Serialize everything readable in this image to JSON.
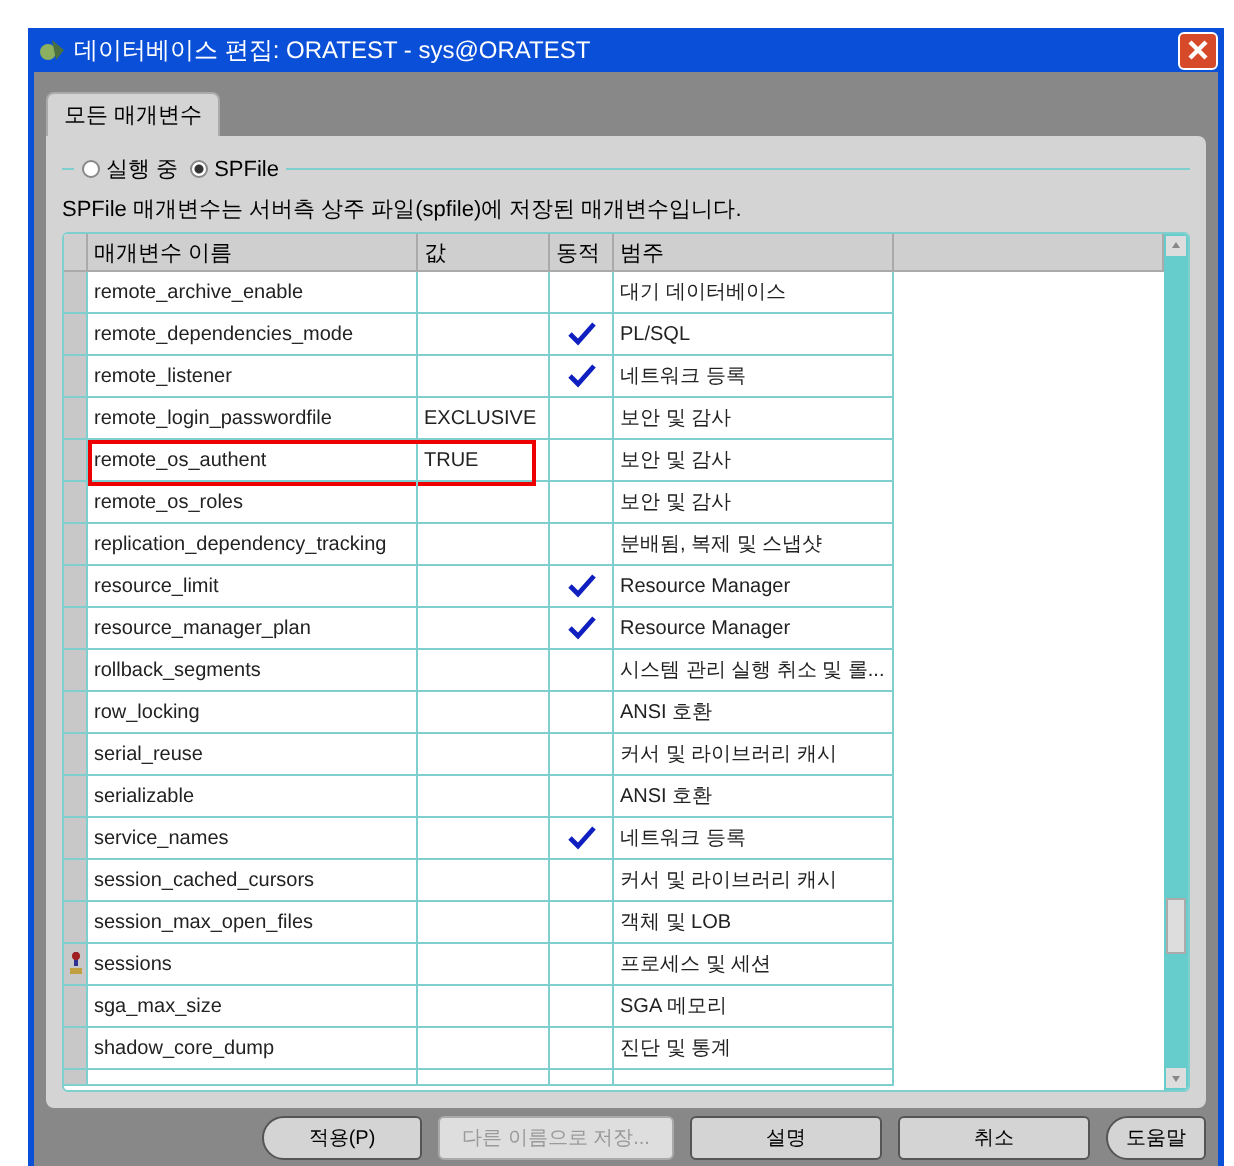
{
  "window": {
    "title": "데이터베이스 편집: ORATEST - sys@ORATEST"
  },
  "tabs": [
    {
      "label": "모든 매개변수",
      "selected": true
    }
  ],
  "source_options": [
    {
      "label": "실행 중",
      "selected": false
    },
    {
      "label": "SPFile",
      "selected": true
    }
  ],
  "description": "SPFile 매개변수는 서버측 상주 파일(spfile)에 저장된 매개변수입니다.",
  "table": {
    "columns": [
      "매개변수 이름",
      "값",
      "동적",
      "범주"
    ],
    "rows": [
      {
        "name": "remote_archive_enable",
        "dynamic": false,
        "category": "대기 데이터베이스",
        "highlighted": false,
        "flagged": false
      },
      {
        "name": "remote_dependencies_mode",
        "dynamic": true,
        "category": "PL/SQL",
        "highlighted": false,
        "flagged": false
      },
      {
        "name": "remote_listener",
        "dynamic": true,
        "category": "네트워크 등록",
        "highlighted": false,
        "flagged": false
      },
      {
        "name": "remote_login_passwordfile",
        "value": "EXCLUSIVE",
        "dynamic": false,
        "category": "보안 및 감사",
        "highlighted": false,
        "flagged": false
      },
      {
        "name": "remote_os_authent",
        "value": "TRUE",
        "dynamic": false,
        "category": "보안 및 감사",
        "highlighted": true,
        "flagged": false
      },
      {
        "name": "remote_os_roles",
        "dynamic": false,
        "category": "보안 및 감사",
        "highlighted": false,
        "flagged": false
      },
      {
        "name": "replication_dependency_tracking",
        "dynamic": false,
        "category": "분배됨, 복제 및 스냅샷",
        "highlighted": false,
        "flagged": false
      },
      {
        "name": "resource_limit",
        "dynamic": true,
        "category": "Resource Manager",
        "highlighted": false,
        "flagged": false
      },
      {
        "name": "resource_manager_plan",
        "dynamic": true,
        "category": "Resource Manager",
        "highlighted": false,
        "flagged": false
      },
      {
        "name": "rollback_segments",
        "dynamic": false,
        "category": "시스템 관리 실행 취소 및 롤...",
        "highlighted": false,
        "flagged": false
      },
      {
        "name": "row_locking",
        "dynamic": false,
        "category": "ANSI 호환",
        "highlighted": false,
        "flagged": false
      },
      {
        "name": "serial_reuse",
        "dynamic": false,
        "category": "커서 및 라이브러리 캐시",
        "highlighted": false,
        "flagged": false
      },
      {
        "name": "serializable",
        "dynamic": false,
        "category": "ANSI 호환",
        "highlighted": false,
        "flagged": false
      },
      {
        "name": "service_names",
        "dynamic": true,
        "category": "네트워크 등록",
        "highlighted": false,
        "flagged": false
      },
      {
        "name": "session_cached_cursors",
        "dynamic": false,
        "category": "커서 및 라이브러리 캐시",
        "highlighted": false,
        "flagged": false
      },
      {
        "name": "session_max_open_files",
        "dynamic": false,
        "category": "객체 및 LOB",
        "highlighted": false,
        "flagged": false
      },
      {
        "name": "sessions",
        "dynamic": false,
        "category": "프로세스 및 세션",
        "highlighted": false,
        "flagged": true
      },
      {
        "name": "sga_max_size",
        "dynamic": false,
        "category": "SGA 메모리",
        "highlighted": false,
        "flagged": false
      },
      {
        "name": "shadow_core_dump",
        "dynamic": false,
        "category": "진단 및 통계",
        "highlighted": false,
        "flagged": false
      }
    ]
  },
  "buttons": [
    {
      "label": "적용(P)",
      "disabled": false
    },
    {
      "label": "다른 이름으로 저장...",
      "disabled": true
    },
    {
      "label": "설명",
      "disabled": false
    },
    {
      "label": "취소",
      "disabled": false
    },
    {
      "label": "도움말",
      "disabled": false
    }
  ]
}
